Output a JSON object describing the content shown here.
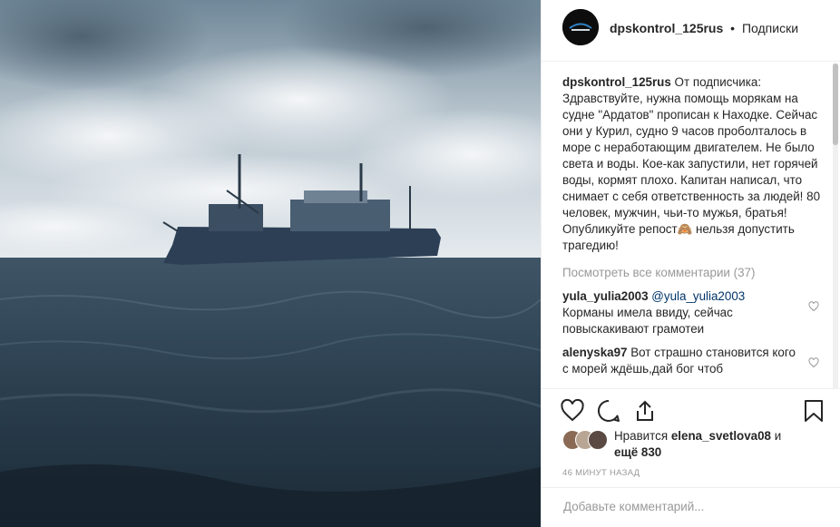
{
  "post": {
    "username": "dpskontrol_125rus",
    "separator": "•",
    "follow_label": "Подписки",
    "caption": "От подписчика: Здравствуйте, нужна помощь морякам на судне \"Ардатов\" прописан к Находке. Сейчас они у Курил, судно 9 часов проболталось в море с неработающим двигателем. Не было света и воды. Кое-как запустили, нет горячей воды, кормят плохо. Капитан написал, что снимает с себя ответственность за людей! 80 человек, мужчин, чьи-то мужья, братья! Опубликуйте репост🙈 нельзя допустить трагедию!"
  },
  "comments": {
    "view_all": "Посмотреть все комментарии (37)",
    "items": [
      {
        "user": "yula_yulia2003",
        "mention": "@yula_yulia2003",
        "text": "Корманы имела ввиду, сейчас повыскакивают грамотеи"
      },
      {
        "user": "alenyska97",
        "text": "Вот страшно становится кого с морей ждёшь,дай бог чтоб"
      }
    ]
  },
  "likes": {
    "prefix": "Нравится",
    "user": "elena_svetlova08",
    "conj": "и",
    "more": "ещё 830"
  },
  "timestamp": "46 МИНУТ НАЗАД",
  "add_comment": {
    "placeholder": "Добавьте комментарий..."
  },
  "icons": {
    "like": "heart-icon",
    "comment": "comment-icon",
    "share": "share-icon",
    "save": "bookmark-icon"
  },
  "colors": {
    "text": "#262626",
    "muted": "#999999",
    "link": "#003569",
    "border": "#efefef"
  }
}
